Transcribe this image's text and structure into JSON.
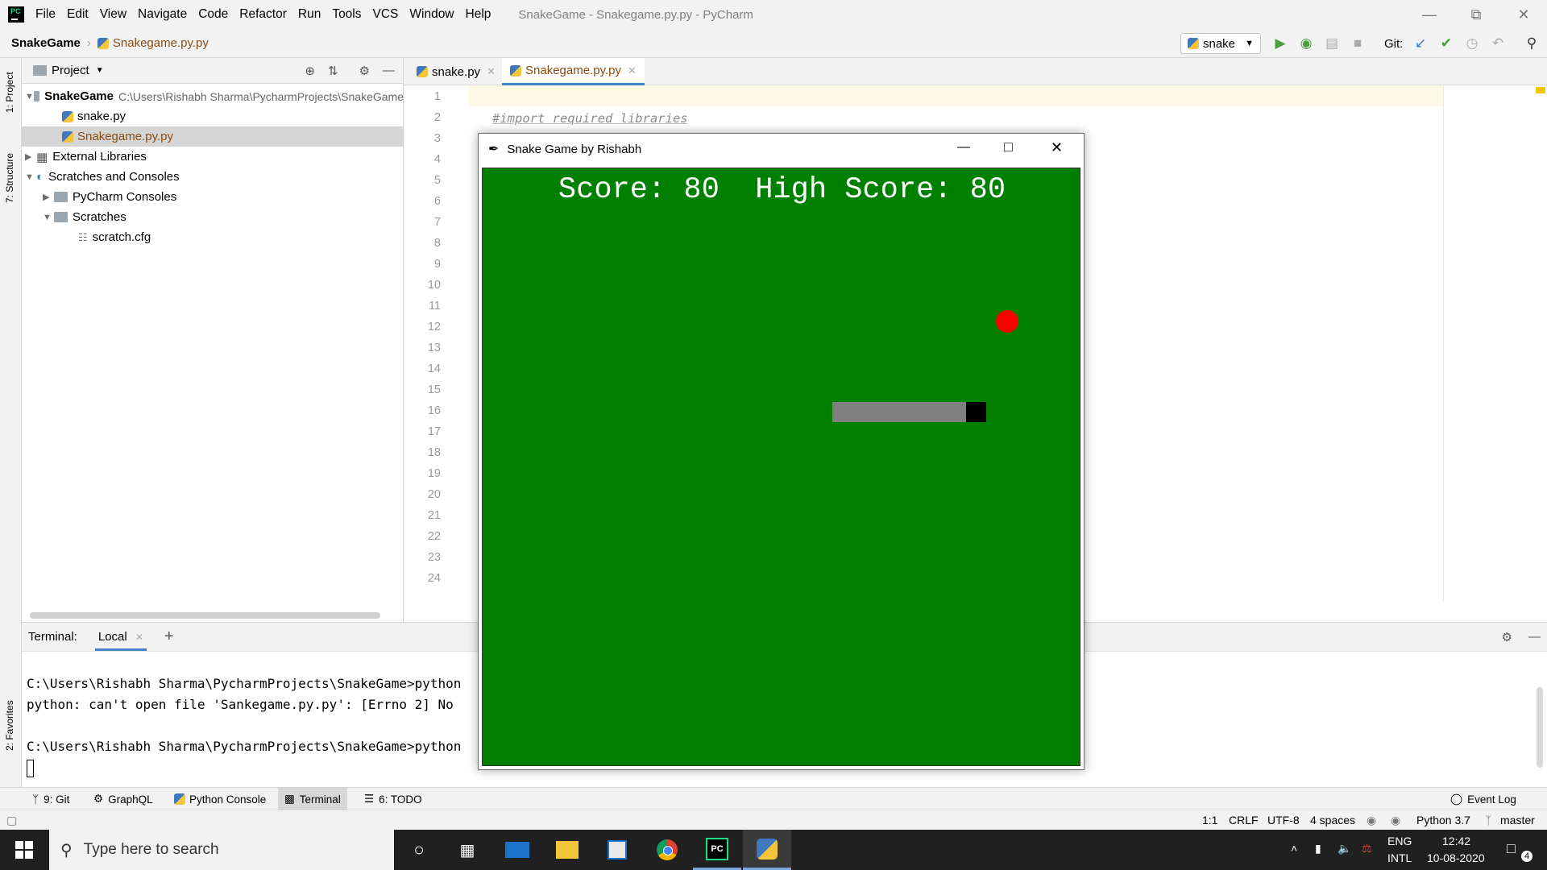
{
  "menu": {
    "items": [
      "File",
      "Edit",
      "View",
      "Navigate",
      "Code",
      "Refactor",
      "Run",
      "Tools",
      "VCS",
      "Window",
      "Help"
    ],
    "window_title": "SnakeGame - Snakegame.py.py - PyCharm"
  },
  "navbar": {
    "project": "SnakeGame",
    "file": "Snakegame.py.py",
    "run_config": "snake",
    "git_label": "Git:"
  },
  "sidebar": {
    "project_tab": "1: Project",
    "structure_tab": "7: Structure",
    "favorites_tab": "2: Favorites"
  },
  "project_panel": {
    "header": "Project",
    "root_name": "SnakeGame",
    "root_path": "C:\\Users\\Rishabh Sharma\\PycharmProjects\\SnakeGame",
    "files": [
      "snake.py",
      "Snakegame.py.py"
    ],
    "external_libraries": "External Libraries",
    "scratches_and_consoles": "Scratches and Consoles",
    "pycharm_consoles": "PyCharm Consoles",
    "scratches": "Scratches",
    "scratch_file": "scratch.cfg"
  },
  "editor": {
    "tabs": [
      {
        "label": "snake.py"
      },
      {
        "label": "Snakegame.py.py"
      }
    ],
    "line_numbers": [
      "1",
      "2",
      "3",
      "4",
      "5",
      "6",
      "7",
      "8",
      "9",
      "10",
      "11",
      "12",
      "13",
      "14",
      "15",
      "16",
      "17",
      "18",
      "19",
      "20",
      "21",
      "22",
      "23",
      "24"
    ],
    "comment_line": "#import required libraries"
  },
  "terminal": {
    "label": "Terminal:",
    "tab": "Local",
    "add": "+",
    "lines": [
      "C:\\Users\\Rishabh Sharma\\PycharmProjects\\SnakeGame>python",
      "python: can't open file 'Sankegame.py.py': [Errno 2] No",
      "C:\\Users\\Rishabh Sharma\\PycharmProjects\\SnakeGame>python"
    ]
  },
  "tool_windows": {
    "git": "9: Git",
    "graphql": "GraphQL",
    "python_console": "Python Console",
    "terminal": "Terminal",
    "todo": "6: TODO",
    "event_log": "Event Log"
  },
  "status_bar": {
    "position": "1:1",
    "line_sep": "CRLF",
    "encoding": "UTF-8",
    "indent": "4 spaces",
    "interpreter": "Python 3.7",
    "branch": "master"
  },
  "snake_game": {
    "window_title": "Snake Game by Rishabh",
    "score_label": "Score:",
    "score": 80,
    "high_score_label": "High Score:",
    "high_score": 80,
    "background_color": "#008000",
    "food_color": "#ff0000",
    "snake_body_color": "#808080",
    "snake_head_color": "#000000"
  },
  "taskbar": {
    "search_placeholder": "Type here to search",
    "lang_top": "ENG",
    "lang_bottom": "INTL",
    "time": "12:42",
    "date": "10-08-2020",
    "notifications": "4"
  }
}
